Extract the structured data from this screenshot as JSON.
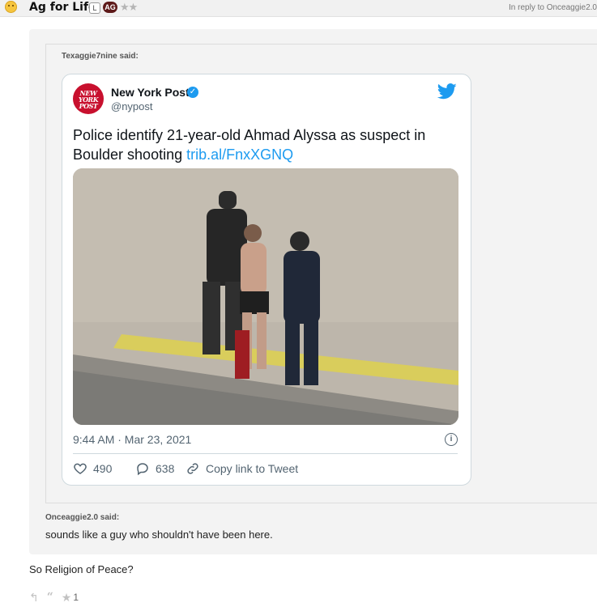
{
  "header": {
    "username": "Ag for Life",
    "badge_l": "L",
    "badge_ag": "AG",
    "stars": "★★",
    "reply_to": "In reply to Onceaggie2.0"
  },
  "outer_quote": {
    "author": "Texaggie7nine said:"
  },
  "tweet": {
    "account_name": "New York Post",
    "handle": "@nypost",
    "logo_text": "NEW YORK POST",
    "text": "Police identify 21-year-old Ahmad Alyssa as suspect in Boulder shooting ",
    "link": "trib.al/FnxXGNQ",
    "timestamp": "9:44 AM · Mar 23, 2021",
    "likes": "490",
    "replies": "638",
    "copy_link": "Copy link to Tweet",
    "colors": {
      "accent": "#1d9bf0",
      "logo": "#c8102e"
    }
  },
  "inner_quote": {
    "author": "Onceaggie2.0 said:",
    "text": "sounds like a guy who shouldn't have been here."
  },
  "post": {
    "text": "So Religion of Peace?",
    "like_count": "1",
    "icons": [
      "reply-icon",
      "quote-icon",
      "star-icon"
    ]
  }
}
